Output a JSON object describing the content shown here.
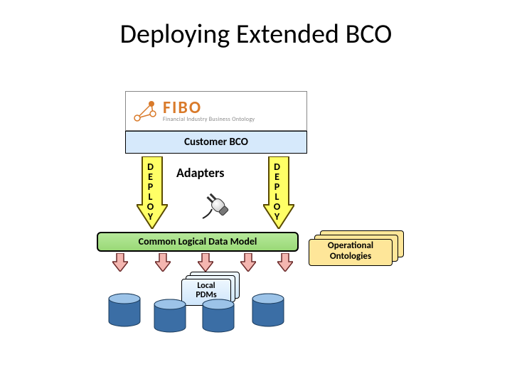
{
  "title": "Deploying Extended BCO",
  "fibo": {
    "name": "FIBO",
    "subtitle": "Financial Industry Business Ontology"
  },
  "customer_bco": "Customer BCO",
  "deploy_label": "DEPLOY",
  "adapters_label": "Adapters",
  "cldm_label": "Common Logical Data Model",
  "local_pdms": {
    "line1": "Local",
    "line2": "PDMs"
  },
  "operational_ontologies": {
    "line1": "Operational",
    "line2": "Ontologies"
  }
}
